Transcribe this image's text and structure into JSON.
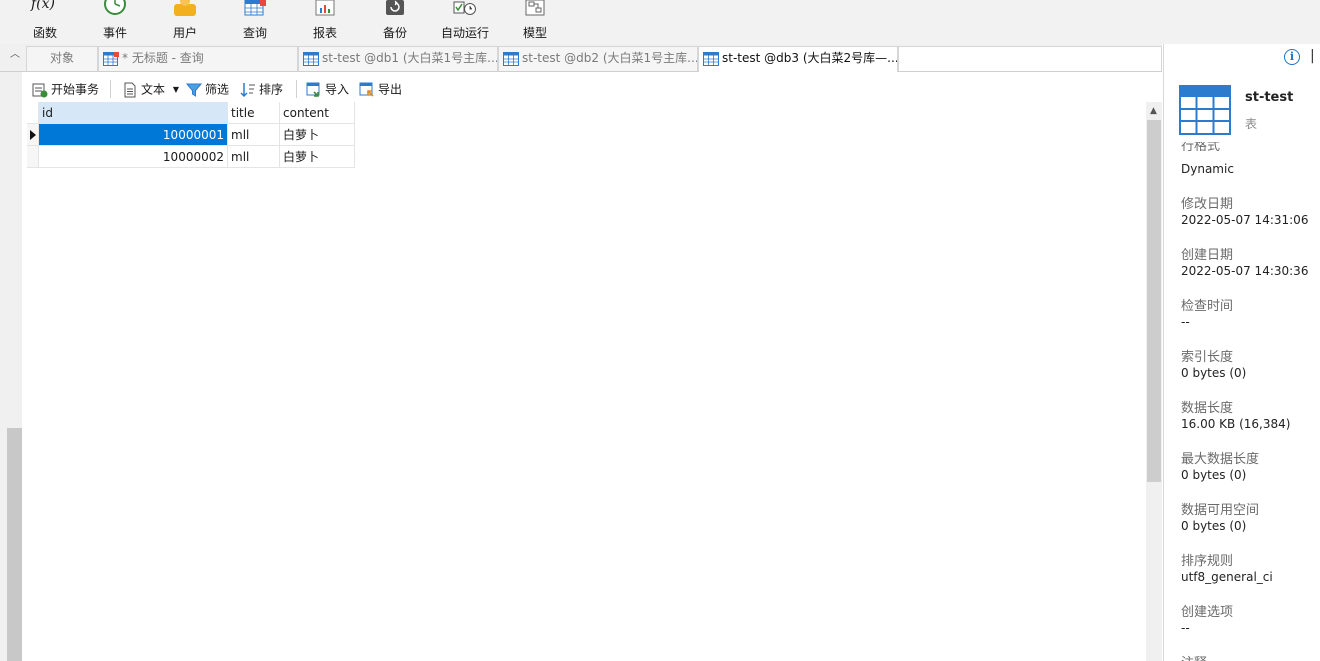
{
  "toolbar": {
    "items": [
      {
        "label": "函数",
        "icon": "function-icon"
      },
      {
        "label": "事件",
        "icon": "event-clock-icon"
      },
      {
        "label": "用户",
        "icon": "user-icon"
      },
      {
        "label": "查询",
        "icon": "query-icon"
      },
      {
        "label": "报表",
        "icon": "report-icon"
      },
      {
        "label": "备份",
        "icon": "backup-icon"
      },
      {
        "label": "自动运行",
        "icon": "auto-run-icon"
      },
      {
        "label": "模型",
        "icon": "model-icon"
      }
    ],
    "function_glyph": "f(x)"
  },
  "tabs": [
    {
      "label": "对象",
      "icon": ""
    },
    {
      "label": "* 无标题 - 查询",
      "icon": "query-table-icon"
    },
    {
      "label": "st-test @db1 (大白菜1号主库...",
      "icon": "table-icon"
    },
    {
      "label": "st-test @db2 (大白菜1号主库...",
      "icon": "table-icon"
    },
    {
      "label": "st-test @db3 (大白菜2号库—...",
      "icon": "table-icon",
      "active": true
    }
  ],
  "data_toolbar": {
    "begin_transaction": "开始事务",
    "text": "文本",
    "filter": "筛选",
    "sort": "排序",
    "import": "导入",
    "export": "导出"
  },
  "grid": {
    "columns": [
      "id",
      "title",
      "content"
    ],
    "rows": [
      {
        "id": "10000001",
        "title": "mll",
        "content": "白萝卜",
        "selected": true
      },
      {
        "id": "10000002",
        "title": "mll",
        "content": "白萝卜",
        "selected": false
      }
    ]
  },
  "info_panel": {
    "name": "st-test",
    "type": "表",
    "partial_label": "行格式",
    "properties": [
      {
        "label": "",
        "value": "Dynamic"
      },
      {
        "label": "修改日期",
        "value": "2022-05-07 14:31:06"
      },
      {
        "label": "创建日期",
        "value": "2022-05-07 14:30:36"
      },
      {
        "label": "检查时间",
        "value": "--"
      },
      {
        "label": "索引长度",
        "value": "0 bytes (0)"
      },
      {
        "label": "数据长度",
        "value": "16.00 KB (16,384)"
      },
      {
        "label": "最大数据长度",
        "value": "0 bytes (0)"
      },
      {
        "label": "数据可用空间",
        "value": "0 bytes (0)"
      },
      {
        "label": "排序规则",
        "value": "utf8_general_ci"
      },
      {
        "label": "创建选项",
        "value": "--"
      },
      {
        "label": "注释",
        "value": ""
      }
    ],
    "info_glyph": "i",
    "close_glyph": "|"
  },
  "colors": {
    "accent": "#0078d7",
    "table_icon_blue": "#2b7bcf",
    "toolbar_bg": "#f2f2f2"
  }
}
